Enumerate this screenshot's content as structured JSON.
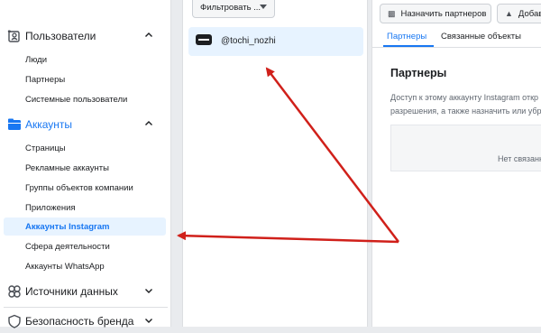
{
  "sidebar": {
    "users_section": {
      "label": "Пользователи",
      "icon": "users-icon"
    },
    "users_items": [
      "Люди",
      "Партнеры",
      "Системные пользователи"
    ],
    "accounts_section": {
      "label": "Аккаунты",
      "icon": "accounts-icon"
    },
    "accounts_items": [
      "Страницы",
      "Рекламные аккаунты",
      "Группы объектов компании",
      "Приложения",
      "Аккаунты Instagram",
      "Сфера деятельности",
      "Аккаунты WhatsApp"
    ],
    "active_item": "Аккаунты Instagram",
    "data_sources_section": {
      "label": "Источники данных",
      "icon": "data-sources-icon"
    },
    "brand_safety_section": {
      "label": "Безопасность бренда",
      "icon": "shield-icon"
    }
  },
  "middle": {
    "filter_label": "Фильтровать ...",
    "account_name": "@tochi_nozhi"
  },
  "right": {
    "assign_partners": "Назначить партнеров",
    "add_label": "Добави",
    "tabs": [
      "Партнеры",
      "Связанные объекты"
    ],
    "title": "Партнеры",
    "desc_line1": "Доступ к этому аккаунту Instagram откр",
    "desc_line2": "разрешения, а также назначить или убр",
    "empty_text": "Нет связанных"
  },
  "colors": {
    "accent": "#1877f2",
    "arrow": "#d0201a",
    "active_bg": "#e7f3ff"
  }
}
